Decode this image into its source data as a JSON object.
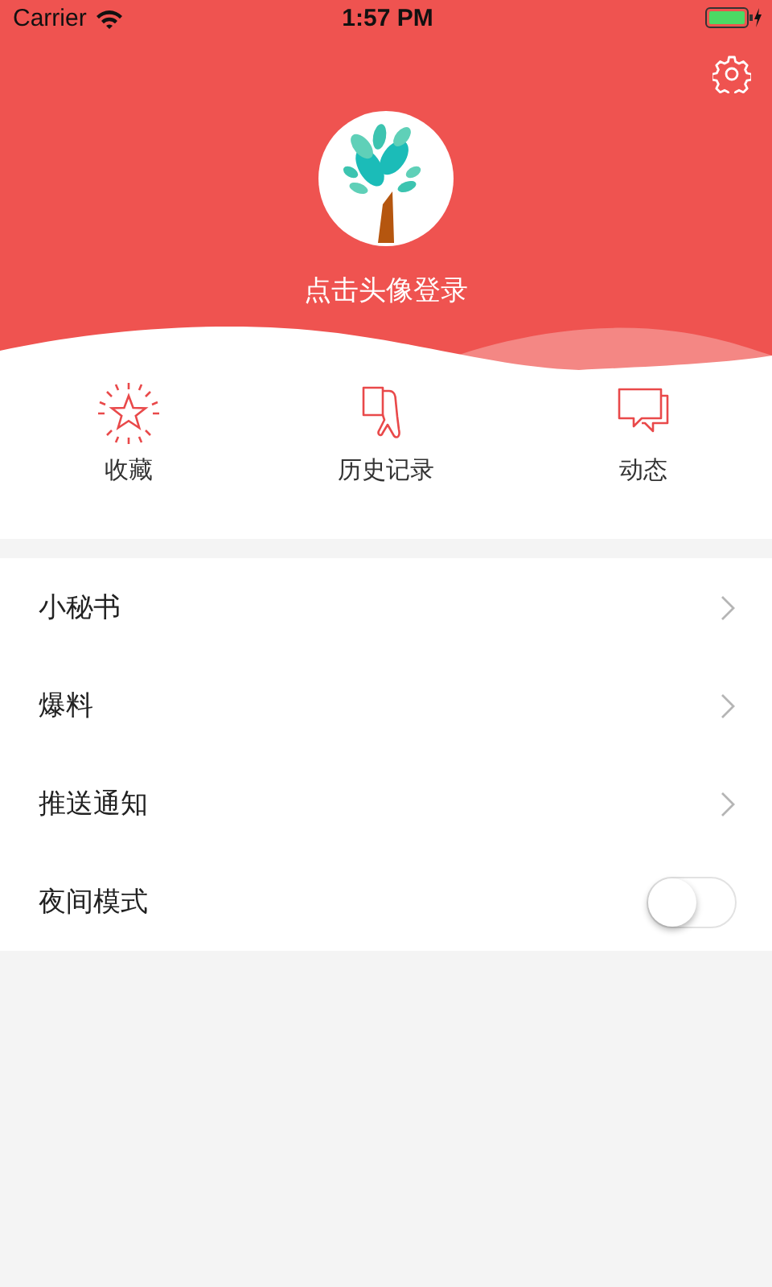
{
  "status_bar": {
    "carrier": "Carrier",
    "time": "1:57 PM"
  },
  "header": {
    "login_prompt": "点击头像登录"
  },
  "quick_actions": [
    {
      "kind": "star",
      "label": "收藏"
    },
    {
      "kind": "history",
      "label": "历史记录"
    },
    {
      "kind": "messages",
      "label": "动态"
    }
  ],
  "menu": [
    {
      "kind": "link",
      "label": "小秘书"
    },
    {
      "kind": "link",
      "label": "爆料"
    },
    {
      "kind": "link",
      "label": "推送通知"
    },
    {
      "kind": "toggle",
      "label": "夜间模式",
      "on": false
    }
  ]
}
